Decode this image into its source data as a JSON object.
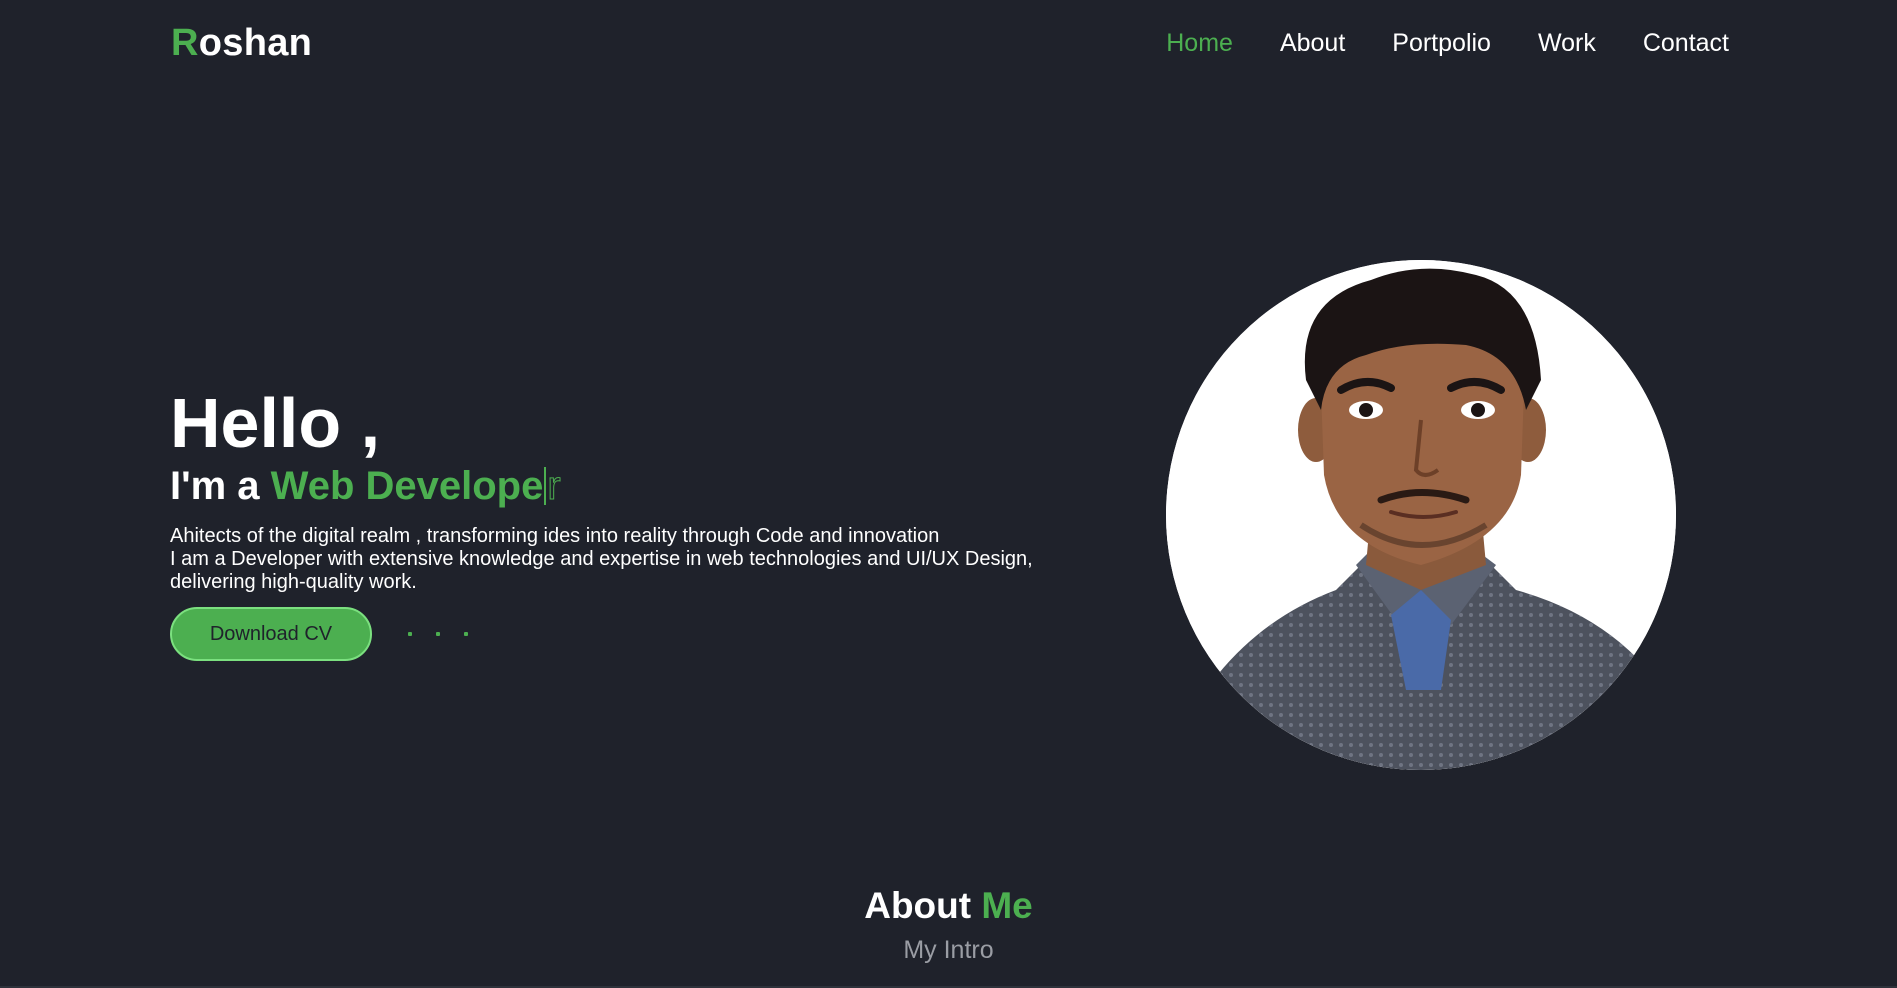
{
  "header": {
    "logo_first": "R",
    "logo_rest": "oshan",
    "nav": [
      {
        "label": "Home",
        "active": true
      },
      {
        "label": "About",
        "active": false
      },
      {
        "label": "Portpolio",
        "active": false
      },
      {
        "label": "Work",
        "active": false
      },
      {
        "label": "Contact",
        "active": false
      }
    ]
  },
  "hero": {
    "greeting": "Hello ,",
    "intro_prefix": "I'm a ",
    "role_typed": "Web Develope",
    "role_pending": "r",
    "description_lines": [
      "Ahitects of the digital realm , transforming ides into reality through Code and innovation",
      "I am a Developer with extensive knowledge and expertise in web technologies and UI/UX Design,",
      "delivering high-quality work."
    ],
    "download_label": "Download CV"
  },
  "about": {
    "title_main": "About ",
    "title_accent": "Me",
    "subtitle": "My Intro"
  },
  "colors": {
    "background": "#1f222b",
    "accent": "#4caf50",
    "text": "#ffffff",
    "muted": "#9a9da4"
  },
  "icons": {
    "portrait": "profile-photo"
  }
}
